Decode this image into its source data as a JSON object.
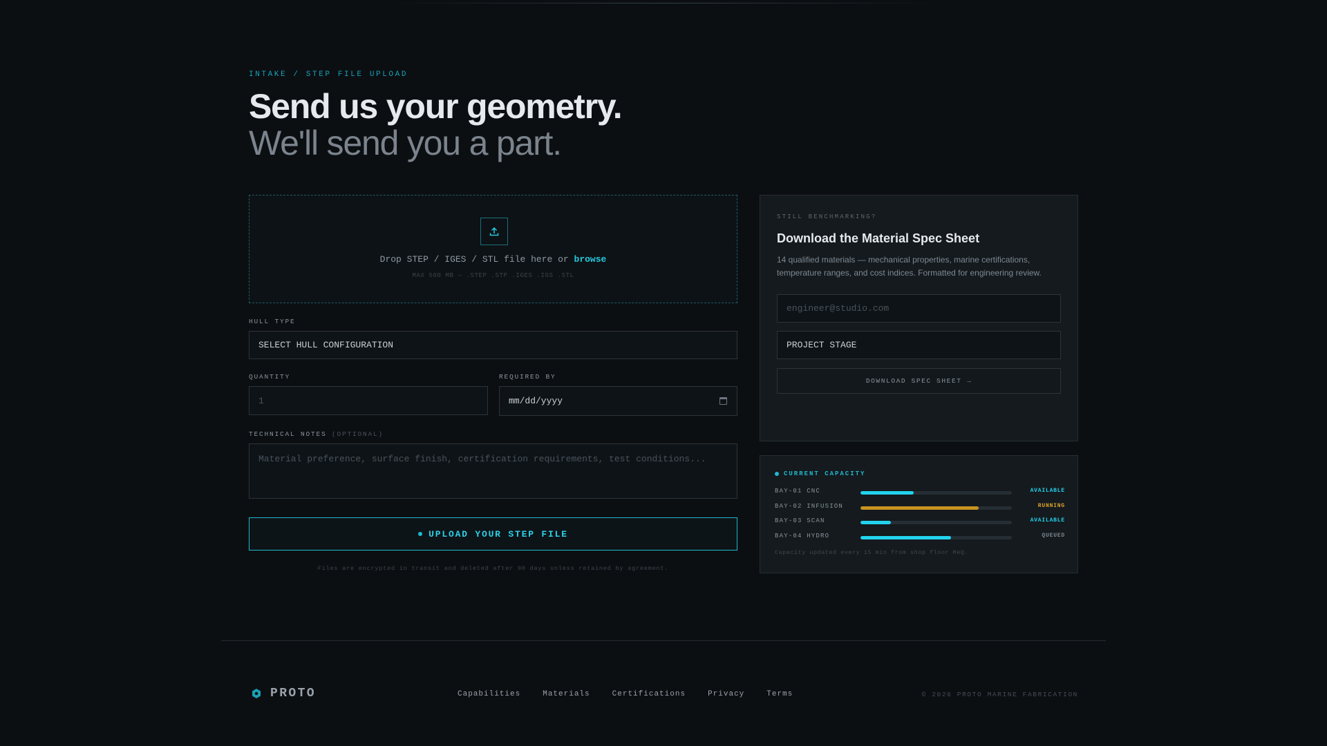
{
  "eyebrow": "INTAKE / STEP FILE UPLOAD",
  "headline": "Send us your geometry.",
  "subheadline": "We'll send you a part.",
  "dropzone": {
    "icon": "upload-icon",
    "text_prefix": "Drop STEP / IGES / STL file here or",
    "browse_label": "browse",
    "hint": "MAX 500 MB — .STEP .STP .IGES .IGS .STL"
  },
  "form": {
    "hull_type_label": "HULL TYPE",
    "hull_type_value": "SELECT HULL CONFIGURATION",
    "quantity_label": "QUANTITY",
    "quantity_placeholder": "1",
    "required_by_label": "REQUIRED BY",
    "required_by_value": "mm/dd/yyyy",
    "notes_label": "TECHNICAL NOTES",
    "notes_optional": "(OPTIONAL)",
    "notes_placeholder": "Material preference, surface finish, certification requirements, test conditions...",
    "submit_label": "UPLOAD YOUR STEP FILE",
    "disclaimer": "Files are encrypted in transit and deleted after 90 days unless retained by agreement."
  },
  "spec_sheet": {
    "eyebrow": "STILL BENCHMARKING?",
    "title": "Download the Material Spec Sheet",
    "description": "14 qualified materials — mechanical properties, marine certifications, temperature ranges, and cost indices. Formatted for engineering review.",
    "email_placeholder": "engineer@studio.com",
    "stage_value": "PROJECT STAGE",
    "button_label": "DOWNLOAD SPEC SHEET →"
  },
  "capacity": {
    "title": "CURRENT CAPACITY",
    "bays": [
      {
        "name": "BAY-01 CNC",
        "load": 0.35,
        "status": "AVAILABLE",
        "color": "#22d3ee",
        "status_color": "#22d3ee"
      },
      {
        "name": "BAY-02 INFUSION",
        "load": 0.78,
        "status": "RUNNING",
        "color": "#c8931f",
        "status_color": "#d9a12a"
      },
      {
        "name": "BAY-03 SCAN",
        "load": 0.2,
        "status": "AVAILABLE",
        "color": "#22d3ee",
        "status_color": "#22d3ee"
      },
      {
        "name": "BAY-04 HYDRO",
        "load": 0.6,
        "status": "QUEUED",
        "color": "#22d3ee",
        "status_color": "#7d8790"
      }
    ],
    "footnote": "Capacity updated every 15 min from shop floor MeQ."
  },
  "footer": {
    "brand": "PROTO",
    "nav": [
      "Capabilities",
      "Materials",
      "Certifications",
      "Privacy",
      "Terms"
    ],
    "copyright": "© 2026 PROTO MARINE FABRICATION"
  }
}
